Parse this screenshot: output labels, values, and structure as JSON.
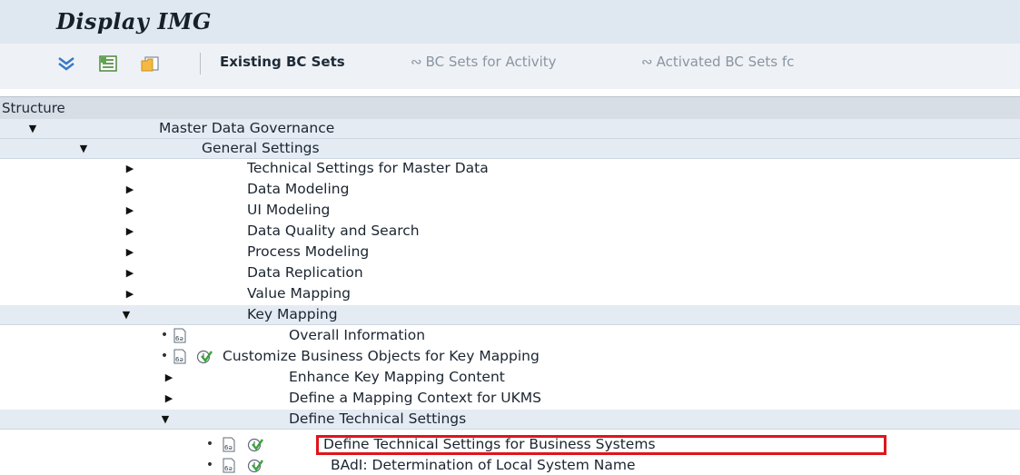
{
  "window": {
    "title": "Display IMG"
  },
  "toolbar": {
    "existing_bc_sets": "Existing BC Sets",
    "bc_sets_for_activity": "BC Sets for Activity",
    "activated_bc_sets": "Activated BC Sets fc"
  },
  "structure": {
    "header": "Structure"
  },
  "tree": {
    "items": [
      {
        "label": "Master Data Governance",
        "expanded": true
      },
      {
        "label": "General Settings",
        "expanded": true
      },
      {
        "label": "Technical Settings for Master Data",
        "expanded": false
      },
      {
        "label": "Data Modeling",
        "expanded": false
      },
      {
        "label": "UI Modeling",
        "expanded": false
      },
      {
        "label": "Data Quality and Search",
        "expanded": false
      },
      {
        "label": "Process Modeling",
        "expanded": false
      },
      {
        "label": "Data Replication",
        "expanded": false
      },
      {
        "label": "Value Mapping",
        "expanded": false
      },
      {
        "label": "Key Mapping",
        "expanded": true
      },
      {
        "label": "Overall Information"
      },
      {
        "label": "Customize Business Objects for Key Mapping"
      },
      {
        "label": "Enhance Key Mapping Content",
        "expanded": false
      },
      {
        "label": "Define a Mapping Context for UKMS",
        "expanded": false
      },
      {
        "label": "Define Technical Settings",
        "expanded": true
      },
      {
        "label": "Define Technical Settings for Business Systems",
        "highlighted": true
      },
      {
        "label": "BAdI: Determination of Local System Name"
      }
    ]
  },
  "colors": {
    "highlight": "#e0141b",
    "row_blue": "#e4ebf3",
    "header": "#d7dee6"
  }
}
